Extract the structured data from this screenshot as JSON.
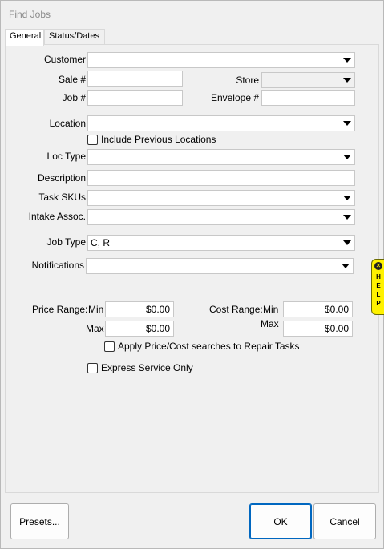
{
  "window": {
    "title": "Find Jobs"
  },
  "tabs": [
    {
      "label": "General"
    },
    {
      "label": "Status/Dates"
    }
  ],
  "form": {
    "customer_label": "Customer",
    "customer_value": "",
    "sale_label": "Sale #",
    "sale_value": "",
    "store_label": "Store",
    "store_value": "",
    "job_label": "Job #",
    "job_value": "",
    "envelope_label": "Envelope #",
    "envelope_value": "",
    "location_label": "Location",
    "location_value": "",
    "include_prev_label": "Include Previous Locations",
    "include_prev_checked": false,
    "loc_type_label": "Loc Type",
    "loc_type_value": "",
    "description_label": "Description",
    "description_value": "",
    "task_skus_label": "Task SKUs",
    "task_skus_value": "",
    "intake_label": "Intake Assoc.",
    "intake_value": "",
    "job_type_label": "Job Type",
    "job_type_value": "C, R",
    "notifications_label": "Notifications",
    "notifications_value": ""
  },
  "ranges": {
    "price_label": "Price Range:",
    "cost_label": "Cost Range:",
    "min_label": "Min",
    "max_label": "Max",
    "price_min": "$0.00",
    "price_max": "$0.00",
    "cost_min": "$0.00",
    "cost_max": "$0.00",
    "apply_label": "Apply Price/Cost searches to Repair Tasks",
    "apply_checked": false,
    "express_label": "Express Service Only",
    "express_checked": false
  },
  "help": {
    "x": "✕",
    "text": "HELP"
  },
  "buttons": {
    "presets": "Presets...",
    "ok": "OK",
    "cancel": "Cancel"
  }
}
